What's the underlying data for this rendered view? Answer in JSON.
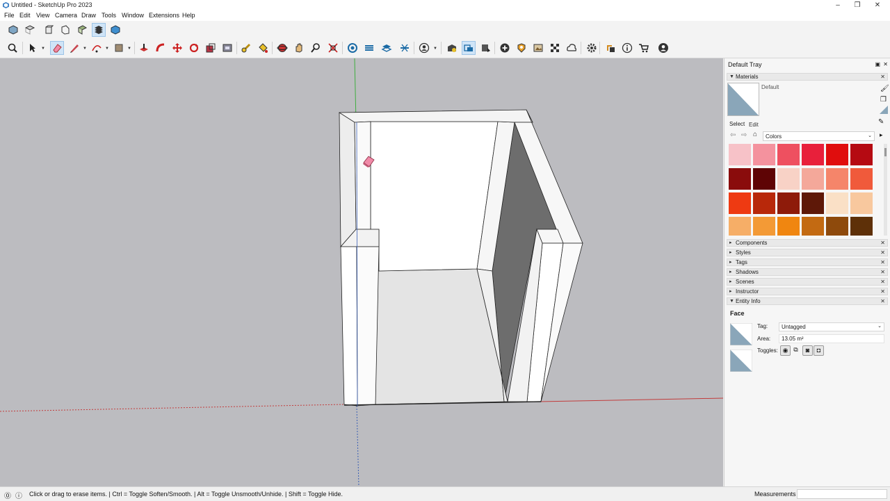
{
  "window": {
    "title": "Untitled - SketchUp Pro 2023"
  },
  "menu": [
    "File",
    "Edit",
    "View",
    "Camera",
    "Draw",
    "Tools",
    "Window",
    "Extensions",
    "Help"
  ],
  "tray": {
    "title": "Default Tray",
    "materials": {
      "header": "Materials",
      "current_name": "Default",
      "tabs": [
        "Select",
        "Edit"
      ],
      "collection": "Colors",
      "swatches": [
        "#f7c2c8",
        "#f4929e",
        "#ee5060",
        "#e8203b",
        "#e00d0d",
        "#b50a12",
        "#8a0c0c",
        "#5e0405",
        "#f8d2c6",
        "#f4a89a",
        "#f5856a",
        "#f05a3b",
        "#ee3a12",
        "#b8280a",
        "#8e1b0a",
        "#5e1808",
        "#fae0c6",
        "#f8c89e",
        "#f6ae67",
        "#f39a36",
        "#f08610",
        "#c36a12",
        "#8e4a0c",
        "#5e3008"
      ]
    },
    "panels": [
      "Components",
      "Styles",
      "Tags",
      "Shadows",
      "Scenes",
      "Instructor"
    ],
    "entity_info": {
      "header": "Entity Info",
      "type": "Face",
      "tag_label": "Tag:",
      "tag_value": "Untagged",
      "area_label": "Area:",
      "area_value": "13.05 m²",
      "toggles_label": "Toggles:"
    }
  },
  "status": {
    "message": "Click or drag to erase items. | Ctrl = Toggle Soften/Smooth. | Alt = Toggle Unsmooth/Unhide. | Shift = Toggle Hide.",
    "measurements_label": "Measurements"
  }
}
